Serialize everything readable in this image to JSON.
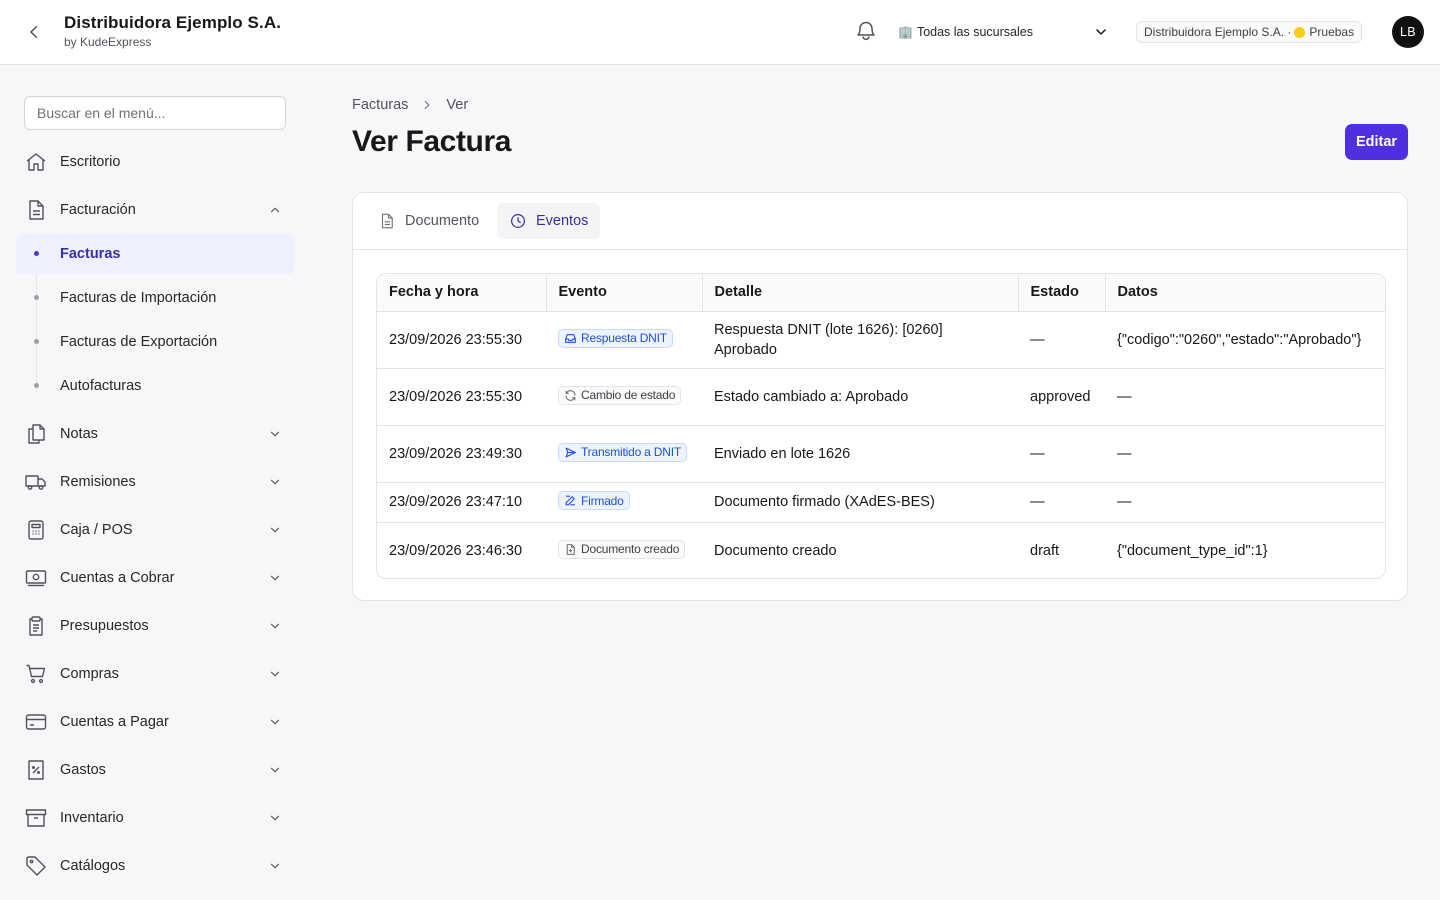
{
  "header": {
    "title": "Distribuidora Ejemplo S.A.",
    "subtitle": "by KudeExpress",
    "branch_select": "Todas las sucursales",
    "company_badge_name": "Distribuidora Ejemplo S.A. ·",
    "company_badge_env": "Pruebas",
    "env_color": "#facc15",
    "avatar_initials": "LB"
  },
  "sidebar": {
    "search_placeholder": "Buscar en el menú...",
    "items": [
      {
        "label": "Escritorio",
        "icon": "home-icon"
      },
      {
        "label": "Facturación",
        "icon": "document-icon",
        "expanded": true
      },
      {
        "label": "Notas",
        "icon": "copy-icon"
      },
      {
        "label": "Remisiones",
        "icon": "truck-icon"
      },
      {
        "label": "Caja / POS",
        "icon": "calculator-icon"
      },
      {
        "label": "Cuentas a Cobrar",
        "icon": "money-icon"
      },
      {
        "label": "Presupuestos",
        "icon": "clipboard-icon"
      },
      {
        "label": "Compras",
        "icon": "cart-icon"
      },
      {
        "label": "Cuentas a Pagar",
        "icon": "credit-card-icon"
      },
      {
        "label": "Gastos",
        "icon": "receipt-percent-icon"
      },
      {
        "label": "Inventario",
        "icon": "archive-icon"
      },
      {
        "label": "Catálogos",
        "icon": "tag-icon"
      }
    ],
    "subitems": [
      {
        "label": "Facturas",
        "active": true
      },
      {
        "label": "Facturas de Importación"
      },
      {
        "label": "Facturas de Exportación"
      },
      {
        "label": "Autofacturas"
      }
    ]
  },
  "breadcrumb": {
    "parent": "Facturas",
    "current": "Ver"
  },
  "page_title": "Ver Factura",
  "edit_label": "Editar",
  "accent_color": "#4f2fe0",
  "tabs": [
    {
      "label": "Documento",
      "icon": "document-icon"
    },
    {
      "label": "Eventos",
      "icon": "clock-icon",
      "active": true
    }
  ],
  "events": {
    "columns": [
      "Fecha y hora",
      "Evento",
      "Detalle",
      "Estado",
      "Datos"
    ],
    "rows": [
      {
        "datetime": "23/09/2026 23:55:30",
        "event": "Respuesta DNIT",
        "event_icon": "inbox-icon",
        "detail": "Respuesta DNIT (lote 1626): [0260] Aprobado",
        "status": "—",
        "data": "{\"codigo\":\"0260\",\"estado\":\"Aprobado\"}"
      },
      {
        "datetime": "23/09/2026 23:55:30",
        "event": "Cambio de estado",
        "event_icon": "refresh-icon",
        "detail": "Estado cambiado a: Aprobado",
        "status": "approved",
        "data": "—"
      },
      {
        "datetime": "23/09/2026 23:49:30",
        "event": "Transmitido a DNIT",
        "event_icon": "send-icon",
        "detail": "Enviado en lote 1626",
        "status": "—",
        "data": "—"
      },
      {
        "datetime": "23/09/2026 23:47:10",
        "event": "Firmado",
        "event_icon": "pen-icon",
        "detail": "Documento firmado (XAdES-BES)",
        "status": "—",
        "data": "—"
      },
      {
        "datetime": "23/09/2026 23:46:30",
        "event": "Documento creado",
        "event_icon": "document-plus-icon",
        "detail": "Documento creado",
        "status": "draft",
        "data": "{\"document_type_id\":1}"
      }
    ]
  }
}
